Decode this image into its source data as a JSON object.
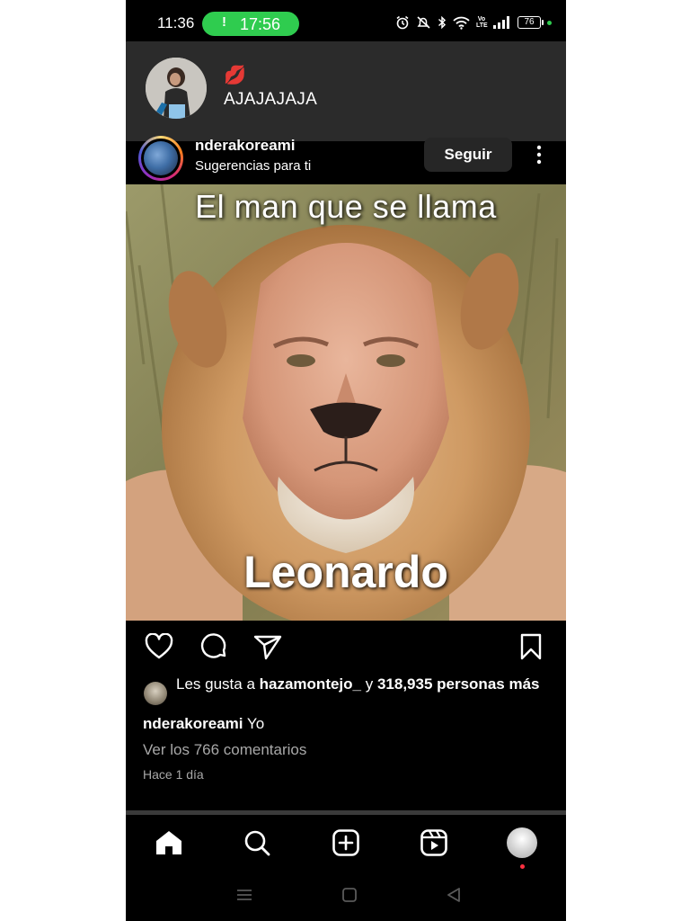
{
  "status_bar": {
    "time": "11:36",
    "call_timer": "17:56",
    "call_icon": "exclamation-icon",
    "lte_label": "Vo LTE",
    "battery": "76",
    "colors": {
      "call_pill": "#2fcc4f",
      "background": "#000000"
    }
  },
  "notification": {
    "emoji": "💋",
    "message": "AJAJAJAJA"
  },
  "post": {
    "username": "nderakoreami",
    "subtitle": "Sugerencias para ti",
    "follow_label": "Seguir",
    "image_text_top": "El man que se llama",
    "image_text_bottom": "Leonardo",
    "likes": {
      "prefix": "Les gusta a",
      "user": "hazamontejo_",
      "connector": "y",
      "count": "318,935 personas más"
    },
    "caption": {
      "username": "nderakoreami",
      "text": "Yo"
    },
    "comments_link": "Ver los 766 comentarios",
    "timestamp": "Hace 1 día"
  },
  "actions": [
    "heart-icon",
    "comment-icon",
    "share-icon",
    "bookmark-icon"
  ],
  "bottom_nav": [
    "home-icon",
    "search-icon",
    "create-post-icon",
    "reels-icon",
    "profile-avatar"
  ],
  "system_nav": [
    "recent-apps-icon",
    "home-square-icon",
    "back-triangle-icon"
  ],
  "colors": {
    "accent_red": "#ff3040",
    "muted_text": "#a8a8a8",
    "button_bg": "#262626"
  }
}
